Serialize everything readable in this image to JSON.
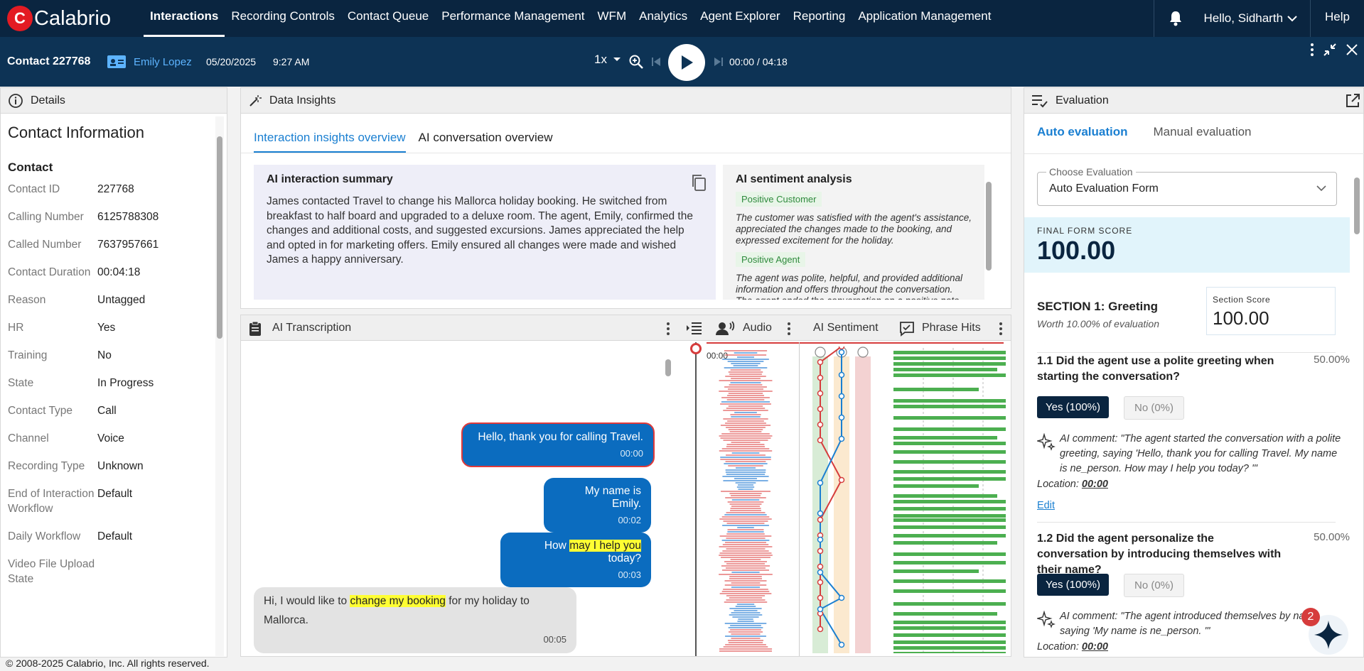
{
  "topnav": {
    "brand": "Calabrio",
    "items": [
      {
        "label": "Interactions",
        "active": true
      },
      {
        "label": "Recording Controls"
      },
      {
        "label": "Contact Queue"
      },
      {
        "label": "Performance Management"
      },
      {
        "label": "WFM"
      },
      {
        "label": "Analytics"
      },
      {
        "label": "Agent Explorer"
      },
      {
        "label": "Reporting"
      },
      {
        "label": "Application Management"
      }
    ],
    "greeting": "Hello, Sidharth",
    "help": "Help"
  },
  "contact": {
    "title": "Contact 227768",
    "agent": "Emily Lopez",
    "date": "05/20/2025",
    "time": "9:27 AM",
    "speed": "1x",
    "progress": "00:00 / 04:18"
  },
  "details": {
    "header": "Details",
    "section": "Contact Information",
    "subsection": "Contact",
    "rows": [
      {
        "k": "Contact ID",
        "v": "227768"
      },
      {
        "k": "Calling Number",
        "v": "6125788308"
      },
      {
        "k": "Called Number",
        "v": "7637957661"
      },
      {
        "k": "Contact Duration",
        "v": "00:04:18"
      },
      {
        "k": "Reason",
        "v": "Untagged"
      },
      {
        "k": "HR",
        "v": "Yes"
      },
      {
        "k": "Training",
        "v": "No"
      },
      {
        "k": "State",
        "v": "In Progress"
      },
      {
        "k": "Contact Type",
        "v": "Call"
      },
      {
        "k": "Channel",
        "v": "Voice"
      },
      {
        "k": "Recording Type",
        "v": "Unknown"
      },
      {
        "k": "End of Interaction Workflow",
        "v": "Default"
      },
      {
        "k": "Daily Workflow",
        "v": "Default"
      },
      {
        "k": "Video File Upload State",
        "v": ""
      }
    ]
  },
  "insights": {
    "header": "Data Insights",
    "tabs": [
      "Interaction insights overview",
      "AI conversation overview"
    ],
    "summary_title": "AI interaction summary",
    "summary": "James contacted Travel to change his Mallorca holiday booking. He switched from breakfast to half board and upgraded to a deluxe room. The agent, Emily, confirmed the changes and additional costs, and suggested excursions. James appreciated the help and opted in for marketing offers. Emily ensured all changes were made and wished James a happy anniversary.",
    "sentiment_title": "AI sentiment analysis",
    "sentiments": [
      {
        "badge": "Positive Customer",
        "text": "The customer was satisfied with the agent's assistance, appreciated the changes made to the booking, and expressed excitement for the holiday."
      },
      {
        "badge": "Positive Agent",
        "text": "The agent was polite, helpful, and provided additional information and offers throughout the conversation. The agent ended the conversation on a positive note."
      }
    ]
  },
  "transcription": {
    "header": "AI Transcription",
    "audio": "Audio",
    "ai_sentiment": "AI Sentiment",
    "phrase_hits": "Phrase Hits",
    "wave_start": "00:00",
    "messages": [
      {
        "text": "Hello, thank you for calling Travel.",
        "time": "00:00"
      },
      {
        "text": "My name is Emily.",
        "time": "00:02"
      },
      {
        "pre": "How ",
        "hl": "may I help you",
        "post": " today?",
        "time": "00:03"
      },
      {
        "pre": "Hi, I would like to ",
        "hl": "change my booking",
        "post": " for my holiday to Mallorca.",
        "time": "00:05"
      }
    ]
  },
  "evaluation": {
    "header": "Evaluation",
    "tabs": [
      "Auto evaluation",
      "Manual evaluation"
    ],
    "choose_label": "Choose Evaluation",
    "form": "Auto Evaluation Form",
    "final_label": "FINAL FORM SCORE",
    "final_score": "100.00",
    "section_title": "SECTION 1: Greeting",
    "section_worth": "Worth 10.00% of evaluation",
    "section_score_label": "Section Score",
    "section_score": "100.00",
    "questions": [
      {
        "title": "1.1 Did the agent use a polite greeting when starting the conversation?",
        "pct": "50.00%",
        "yes": "Yes (100%)",
        "no": "No (0%)",
        "comment": "AI comment: \"The agent started the conversation with a polite greeting, saying 'Hello, thank you for calling Travel. My name is ne_person. How may I help you today? '\"",
        "location_label": "Location:",
        "location": "00:00",
        "edit": "Edit"
      },
      {
        "title": "1.2 Did the agent personalize the conversation by introducing themselves with their name?",
        "pct": "50.00%",
        "yes": "Yes (100%)",
        "no": "No (0%)",
        "comment": "AI comment: \"The agent introduced themselves by name, saying 'My name is ne_person. '\"",
        "location_label": "Location:",
        "location": "00:00"
      }
    ],
    "notif_count": "2"
  },
  "footer": "© 2008-2025 Calabrio, Inc. All rights reserved.",
  "colors": {
    "nav": "#0a2540",
    "contactbar": "#0d3355",
    "accent": "#1a7fd1",
    "brand_red": "#e31b23"
  }
}
